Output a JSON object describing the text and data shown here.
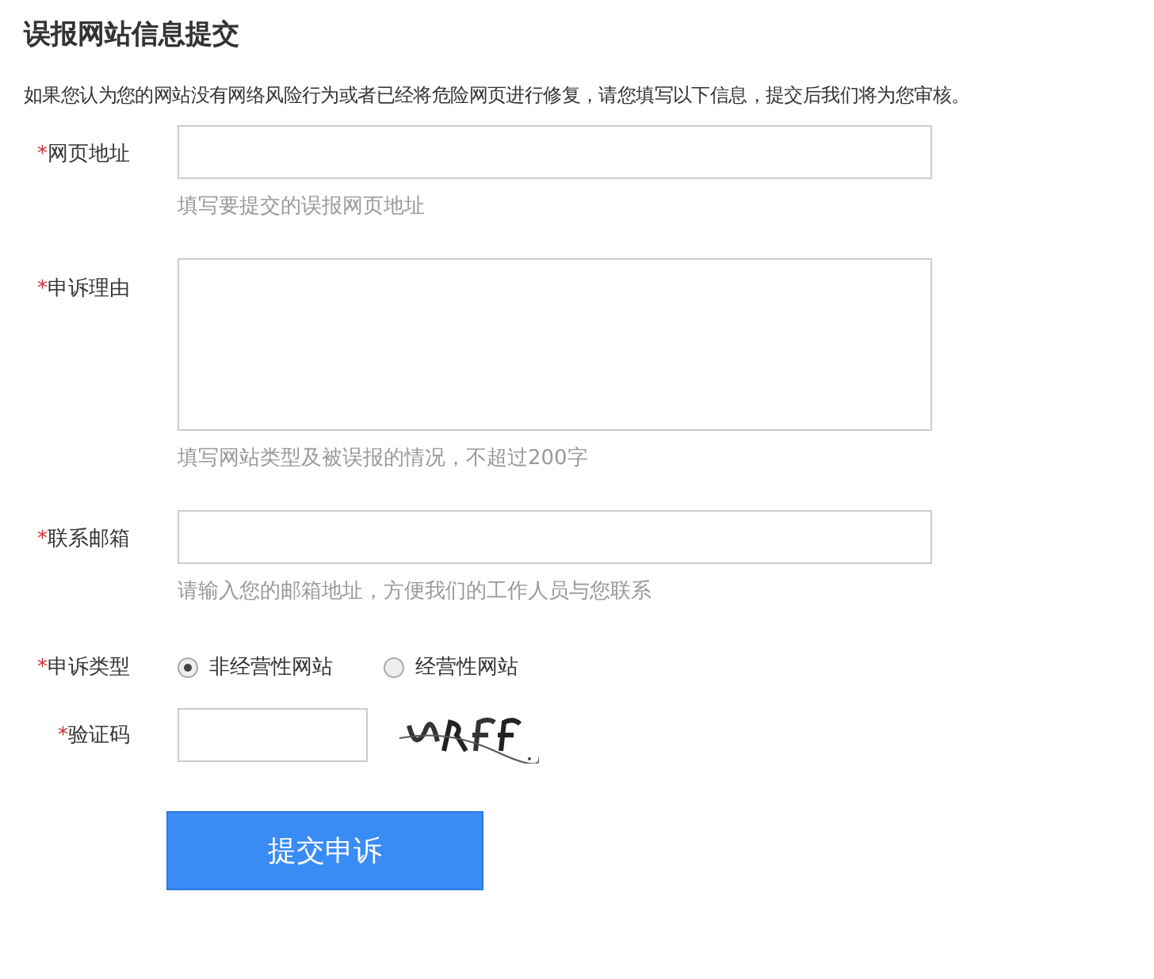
{
  "title": "误报网站信息提交",
  "intro": "如果您认为您的网站没有网络风险行为或者已经将危险网页进行修复，请您填写以下信息，提交后我们将为您审核。",
  "fields": [
    {
      "kind": "text",
      "mark": "*",
      "label": "网页地址",
      "hint": "填写要提交的误报网页地址"
    },
    {
      "kind": "textarea",
      "mark": "*",
      "label": "申诉理由",
      "hint": "填写网站类型及被误报的情况，不超过200字"
    },
    {
      "kind": "text",
      "mark": "*",
      "label": "联系邮箱",
      "hint": "请输入您的邮箱地址，方便我们的工作人员与您联系"
    },
    {
      "kind": "radio",
      "mark": "*",
      "label": "申诉类型",
      "options": [
        {
          "label": "非经营性网站",
          "selected": true
        },
        {
          "label": "经营性网站",
          "selected": false
        }
      ]
    },
    {
      "kind": "captcha",
      "mark": "*",
      "label": "验证码"
    }
  ],
  "submit": "提交申诉"
}
